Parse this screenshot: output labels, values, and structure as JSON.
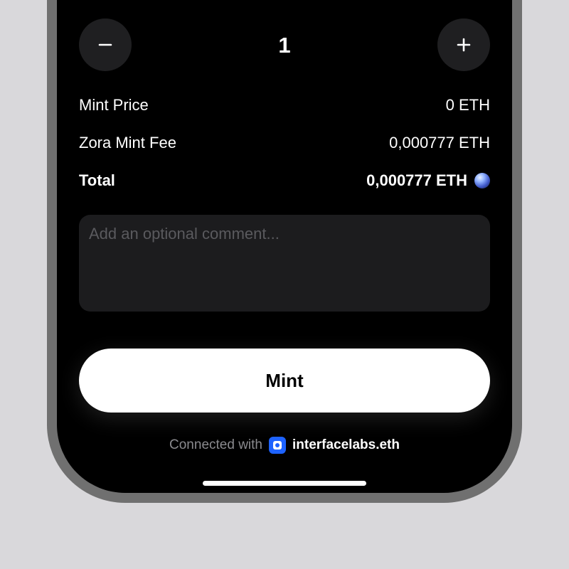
{
  "stepper": {
    "quantity": "1",
    "decrement_icon": "minus-icon",
    "increment_icon": "plus-icon"
  },
  "pricing": {
    "mint_price_label": "Mint Price",
    "mint_price_value": "0 ETH",
    "fee_label": "Zora Mint Fee",
    "fee_value": "0,000777 ETH",
    "total_label": "Total",
    "total_value": "0,000777 ETH",
    "total_icon": "eth-globe-icon"
  },
  "comment": {
    "placeholder": "Add an optional comment..."
  },
  "mint_button": {
    "label": "Mint"
  },
  "connection": {
    "label": "Connected with",
    "wallet_icon": "wallet-icon",
    "account": "interfacelabs.eth"
  },
  "colors": {
    "background": "#d9d8db",
    "screen": "#000000",
    "button_bg": "#1f1f21",
    "input_bg": "#1c1c1e",
    "wallet_blue": "#1e63ff"
  }
}
